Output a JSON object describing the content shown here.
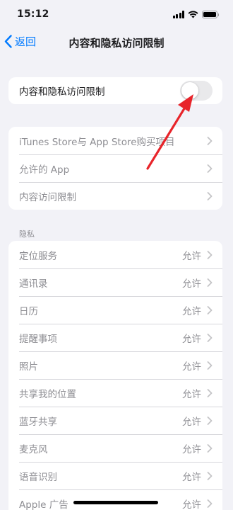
{
  "status_bar": {
    "time": "15:12"
  },
  "nav": {
    "back_label": "返回",
    "title": "内容和隐私访问限制"
  },
  "main_toggle": {
    "label": "内容和隐私访问限制",
    "on": false
  },
  "restrictions": {
    "items": [
      {
        "label": "iTunes Store与 App Store购买项目"
      },
      {
        "label": "允许的 App"
      },
      {
        "label": "内容访问限制"
      }
    ]
  },
  "privacy": {
    "header": "隐私",
    "items": [
      {
        "label": "定位服务",
        "value": "允许"
      },
      {
        "label": "通讯录",
        "value": "允许"
      },
      {
        "label": "日历",
        "value": "允许"
      },
      {
        "label": "提醒事项",
        "value": "允许"
      },
      {
        "label": "照片",
        "value": "允许"
      },
      {
        "label": "共享我的位置",
        "value": "允许"
      },
      {
        "label": "蓝牙共享",
        "value": "允许"
      },
      {
        "label": "麦克风",
        "value": "允许"
      },
      {
        "label": "语音识别",
        "value": "允许"
      },
      {
        "label": "Apple 广告",
        "value": "允许"
      }
    ]
  },
  "colors": {
    "accent": "#007aff",
    "annotation_arrow": "#e8242a",
    "background": "#f2f2f7"
  },
  "icons": [
    "chevron-left-icon",
    "chevron-right-icon",
    "signal-icon",
    "wifi-icon",
    "battery-icon"
  ]
}
